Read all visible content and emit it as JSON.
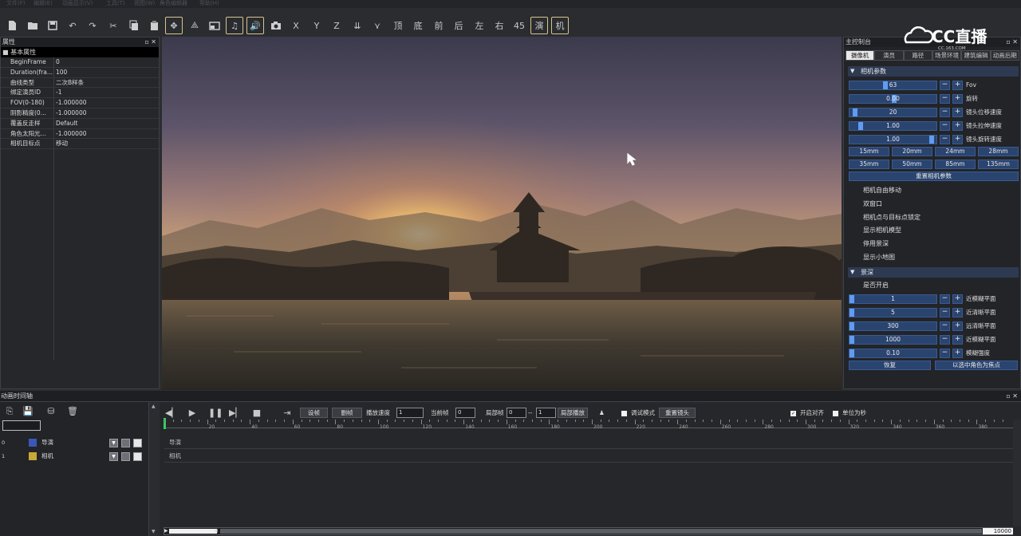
{
  "menu": [
    "文件(F)",
    "编辑(E)",
    "动画显示(V)",
    "工具(T)",
    "视图(W)",
    "角色编辑器",
    "帮助(H)"
  ],
  "toolbar": {
    "axis_labels": [
      "X",
      "Y",
      "Z"
    ],
    "view_labels": [
      "顶",
      "底",
      "前",
      "后",
      "左",
      "右",
      "45"
    ],
    "boxed_labels": [
      "演",
      "机"
    ]
  },
  "left_panel": {
    "title": "属性",
    "pin": "▫ ✕",
    "section": "基本属性",
    "rows": [
      {
        "k": "BeginFrame",
        "v": "0"
      },
      {
        "k": "Duration(fra...",
        "v": "100"
      },
      {
        "k": "曲线类型",
        "v": "二次B样条"
      },
      {
        "k": "绑定演员ID",
        "v": "-1"
      },
      {
        "k": "FOV(0-180)",
        "v": "   -1.000000"
      },
      {
        "k": "阴影精度(0...",
        "v": "   -1.000000"
      },
      {
        "k": "覆盖反走样",
        "v": "Default"
      },
      {
        "k": "角色太阳光...",
        "v": "   -1.000000"
      },
      {
        "k": "相机目标点",
        "v": "移动"
      }
    ]
  },
  "right_panel": {
    "title": "主控制台",
    "logo": "CC直播",
    "logo_sub": "CC.163.COM",
    "tabs": [
      "摄像机",
      "演员",
      "路径",
      "场景环境",
      "建筑编辑",
      "动画后期"
    ],
    "camera_section": "相机参数",
    "sliders": [
      {
        "value": "63",
        "label": "Fov",
        "fill": 0.4
      },
      {
        "value": "0.00",
        "label": "旋转",
        "fill": 0.5
      },
      {
        "value": "20",
        "label": "镜头位移速度",
        "fill": 0.04
      },
      {
        "value": "1.00",
        "label": "镜头拉伸速度",
        "fill": 0.1
      },
      {
        "value": "1.00",
        "label": "镜头旋转速度",
        "fill": 0.95
      }
    ],
    "focal": [
      "15mm",
      "20mm",
      "24mm",
      "28mm",
      "35mm",
      "50mm",
      "85mm",
      "135mm"
    ],
    "reset": "重置相机参数",
    "checks": [
      "相机自由移动",
      "双窗口",
      "相机点与目标点锁定",
      "显示相机模型",
      "停用景深",
      "显示小地图"
    ],
    "dof_section": "景深",
    "dof_enable": "是否开启",
    "dof_sliders": [
      {
        "value": "1",
        "label": "近模糊平面"
      },
      {
        "value": "5",
        "label": "近清晰平面"
      },
      {
        "value": "300",
        "label": "远清晰平面"
      },
      {
        "value": "1000",
        "label": "近模糊平面"
      },
      {
        "value": "0.10",
        "label": "模糊强度"
      }
    ],
    "restore": "恢复",
    "focus_selected": "以选中角色为焦点"
  },
  "timeline": {
    "title": "动画时间轴",
    "btn_setframe": "设帧",
    "btn_delframe": "删帧",
    "speed_label": "播放速度",
    "speed_value": "1",
    "current_label": "当前帧",
    "current_value": "0",
    "local_label": "局部帧",
    "local_from": "0",
    "local_sep": "--",
    "local_to": "1",
    "local_play": "局部播放",
    "debug_label": "调试模式",
    "reset_lens": "重置镜头",
    "snap_label": "开启对齐",
    "unit_label": "单位为秒",
    "ticks": [
      "20",
      "40",
      "60",
      "80",
      "100",
      "120",
      "140",
      "160",
      "180",
      "200",
      "220",
      "240",
      "260",
      "280",
      "300",
      "320",
      "340",
      "360",
      "380"
    ],
    "tracks": [
      {
        "idx": "0",
        "name": "导演",
        "color": "#3b57b8"
      },
      {
        "idx": "1",
        "name": "相机",
        "color": "#c9a83a"
      }
    ],
    "end_frame": "10000"
  }
}
